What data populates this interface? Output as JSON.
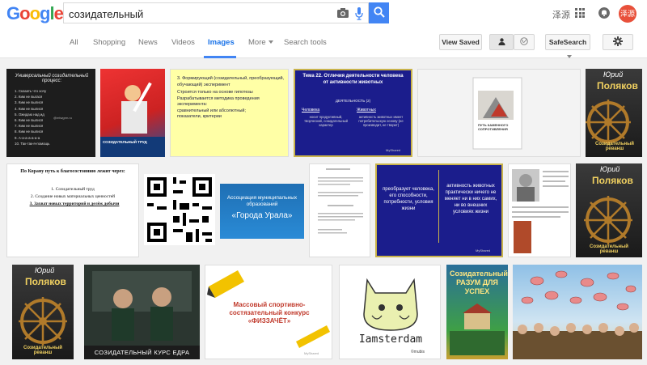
{
  "header": {
    "logo": "Google",
    "query": "созидательный",
    "lang": "泽源",
    "avatar_text": "泽源"
  },
  "nav": {
    "tabs": [
      "All",
      "Shopping",
      "News",
      "Videos",
      "Images",
      "More",
      "Search tools"
    ],
    "view_saved": "View Saved",
    "safesearch": "SafeSearch"
  },
  "images": {
    "r1": {
      "board_title": "Универсальный созидательный процесс:",
      "board_lines": [
        "1. Сказать что хочу",
        "2. Ким не выгася",
        "3. Ким не вылися",
        "4. Ким не вылися",
        "5. Ожидаю над ид",
        "6. Ким не вылися",
        "7. Ким не вылися",
        "8. Ким не вылися",
        "9. А-а-а-а-а-а-а",
        "10. Так-так-я-помощь"
      ],
      "board_handle": "@mtwgrm.ru",
      "poster_text": "СОЗИДАТЕЛЬНЫЙ ТРУД",
      "slide1_lines": [
        "3. Формирующий (созидательный, преобразующий, обучающий) эксперимент",
        "Строится только на основе гипотезы",
        "Разрабатывается методика проведения эксперимента:",
        "сравнительный или абсолютный;",
        "показатели, критерии"
      ],
      "slide2_title": "Тема 22. Отличия деятельности человека от активности животных",
      "slide2_sub": "ДЕЯТЕЛЬНОСТЬ (2)",
      "slide2_col1_head": "Человека",
      "slide2_col1": "носит продуктивный, творческий, созидательный характер",
      "slide2_col2_head": "Животных",
      "slide2_col2": "активность животных имеет потребительскую основу (не производит, не творит)",
      "slide2_brand": "MyShared",
      "book_title": "ПУТЬ КАМЕННОГО СОПРОТИВЛЕНИЯ",
      "cover_author": "Юрий",
      "cover_name": "Поляков",
      "cover_sub": "Созидательный реванш"
    },
    "r2": {
      "doc_lines": [
        "По Корану путь к благосостоянию лежит через:",
        "1. Созидательный труд",
        "2. Создание новых материальных ценностей",
        "3. Захват новых территорий и делёж добычи"
      ],
      "assoc_line1": "Ассоциация муниципальных",
      "assoc_line2": "образований",
      "assoc_title": "«Города Урала»",
      "slide_left": "преобразует человека, его способности, потребности, условия жизни",
      "slide_right": "активность животных практически ничего не меняет ни в них самих, ни во внешних условиях жизни",
      "slide_brand": "MyShared",
      "cover_author": "Юрий",
      "cover_name": "Поляков",
      "cover_sub": "Созидательный реванш"
    },
    "r3": {
      "cover_author": "Юрий",
      "cover_name": "Поляков",
      "cover_sub": "Созидательный реванш",
      "photo_caption": "СОЗИДАТЕЛЬНЫЙ КУРС ЕДРА",
      "contest_title": "Массовый спортивно-состязательный конкурс «ФИЗЗАЧЁТ»",
      "contest_brand": "MyShared",
      "cat_text": "Iamsterdam",
      "cat_credit": "©mubis",
      "razum_title": "Созидательный РАЗУМ ДЛЯ УСПЕХ"
    }
  }
}
